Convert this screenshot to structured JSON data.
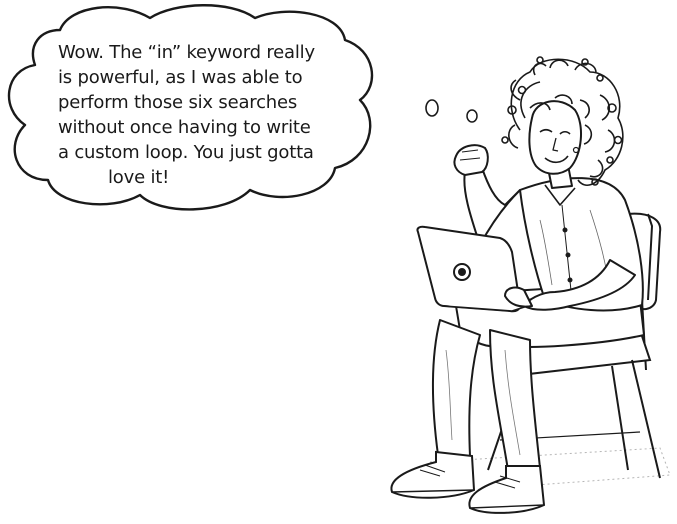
{
  "speech_bubble": {
    "lines": [
      "Wow. The “in” keyword really",
      "is powerful, as I was able to",
      "perform those six searches",
      "without once having to write",
      "a custom loop. You just gotta",
      "love it!"
    ]
  },
  "illustration": {
    "subject": "woman-with-laptop-on-chair",
    "ink_color": "#1a1a1a",
    "paper_color": "#ffffff"
  }
}
